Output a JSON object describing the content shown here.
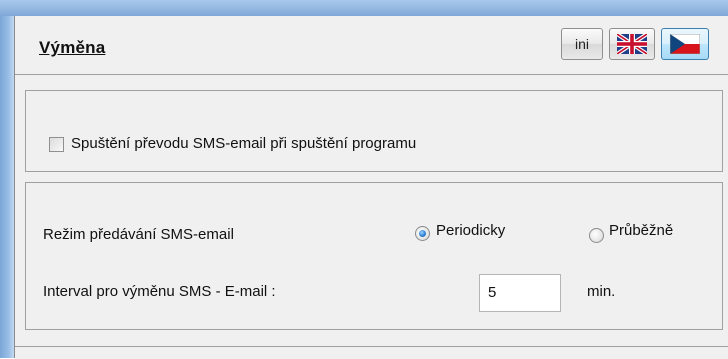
{
  "header": {
    "title": "Výměna",
    "ini_label": "ini",
    "lang_en_icon": "uk-flag-icon",
    "lang_cz_icon": "czech-flag-icon"
  },
  "startup": {
    "checkbox_label": "Spuštění převodu SMS-email při spuštění programu",
    "checked": false
  },
  "transfer": {
    "mode_label": "Režim předávání SMS-email",
    "options": [
      {
        "label": "Periodicky",
        "selected": true
      },
      {
        "label": "Průběžně",
        "selected": false
      }
    ],
    "interval_label": "Interval pro výměnu SMS - E-mail :",
    "interval_value": "5",
    "interval_unit": "min."
  },
  "colors": {
    "frame_blue": "#7fa8d8",
    "panel_bg": "#f0f0f0",
    "active_button": "#bee6fd",
    "radio_fill": "#2a7bd1"
  }
}
